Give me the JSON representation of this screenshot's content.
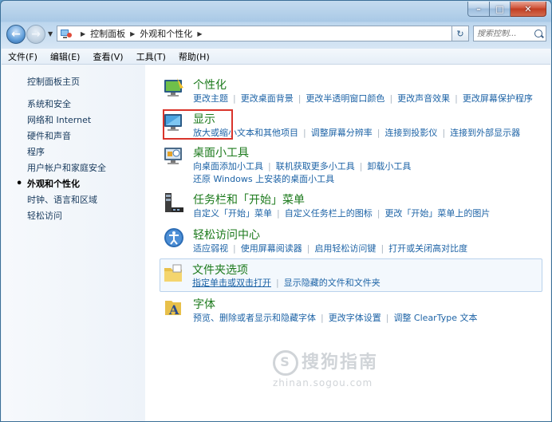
{
  "window": {
    "caption_min": "–",
    "caption_max": "□",
    "caption_close": "✕"
  },
  "address": {
    "crumbs": [
      "控制面板",
      "外观和个性化"
    ],
    "search_placeholder": "搜索控制..."
  },
  "menu": [
    "文件(F)",
    "编辑(E)",
    "查看(V)",
    "工具(T)",
    "帮助(H)"
  ],
  "sidebar": {
    "home": "控制面板主页",
    "items": [
      "系统和安全",
      "网络和 Internet",
      "硬件和声音",
      "程序",
      "用户帐户和家庭安全",
      "外观和个性化",
      "时钟、语言和区域",
      "轻松访问"
    ],
    "active_index": 5
  },
  "categories": [
    {
      "title": "个性化",
      "icon": "personalization-icon",
      "links": [
        "更改主题",
        "更改桌面背景",
        "更改半透明窗口颜色",
        "更改声音效果",
        "更改屏幕保护程序"
      ]
    },
    {
      "title": "显示",
      "icon": "display-icon",
      "links": [
        "放大或缩小文本和其他项目",
        "调整屏幕分辨率",
        "连接到投影仪",
        "连接到外部显示器"
      ]
    },
    {
      "title": "桌面小工具",
      "icon": "gadgets-icon",
      "links": [
        "向桌面添加小工具",
        "联机获取更多小工具",
        "卸载小工具",
        "还原 Windows 上安装的桌面小工具"
      ]
    },
    {
      "title": "任务栏和「开始」菜单",
      "icon": "taskbar-icon",
      "links": [
        "自定义「开始」菜单",
        "自定义任务栏上的图标",
        "更改「开始」菜单上的图片"
      ]
    },
    {
      "title": "轻松访问中心",
      "icon": "ease-of-access-icon",
      "links": [
        "适应弱视",
        "使用屏幕阅读器",
        "启用轻松访问键",
        "打开或关闭高对比度"
      ]
    },
    {
      "title": "文件夹选项",
      "icon": "folder-options-icon",
      "links": [
        "指定单击或双击打开",
        "显示隐藏的文件和文件夹"
      ]
    },
    {
      "title": "字体",
      "icon": "fonts-icon",
      "links": [
        "预览、删除或者显示和隐藏字体",
        "更改字体设置",
        "调整 ClearType 文本"
      ]
    }
  ],
  "watermark": {
    "text": "搜狗指南",
    "url": "zhinan.sogou.com",
    "logo_letter": "S"
  },
  "colors": {
    "link": "#1d63a6",
    "title_green": "#1c7a1c",
    "highlight": "#d9342b"
  }
}
